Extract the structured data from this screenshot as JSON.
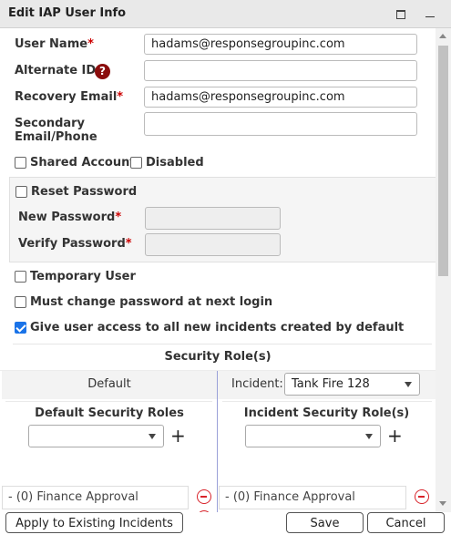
{
  "dialog": {
    "title": "Edit IAP User Info"
  },
  "form": {
    "user_name": {
      "label": "User Name",
      "required_mark": "*",
      "value": "hadams@responsegroupinc.com"
    },
    "alternate_id": {
      "label": "Alternate ID",
      "help": "?",
      "value": ""
    },
    "recovery_email": {
      "label": "Recovery Email",
      "required_mark": "*",
      "value": "hadams@responsegroupinc.com"
    },
    "secondary": {
      "label_line1": "Secondary",
      "label_line2": "Email/Phone",
      "value": ""
    },
    "shared_account": {
      "label": "Shared Account",
      "checked": false
    },
    "disabled": {
      "label": "Disabled",
      "checked": false
    },
    "reset_password": {
      "label": "Reset Password",
      "checked": false
    },
    "new_password": {
      "label": "New Password",
      "required_mark": "*"
    },
    "verify_password": {
      "label": "Verify Password",
      "required_mark": "*"
    },
    "temporary_user": {
      "label": "Temporary User",
      "checked": false
    },
    "must_change": {
      "label": "Must change password at next login",
      "checked": false
    },
    "give_access": {
      "label": "Give user access to all new incidents created by default",
      "checked": true
    }
  },
  "roles": {
    "section_title": "Security Role(s)",
    "default_tab": "Default",
    "incident_label": "Incident:",
    "incident_value": "Tank Fire 128",
    "default_roles_title": "Default Security Roles",
    "incident_roles_title": "Incident Security Role(s)",
    "add_symbol": "+",
    "left_items": [
      "- (0) Finance Approval"
    ],
    "right_items": [
      "- (0) Finance Approval"
    ]
  },
  "footer": {
    "apply": "Apply to Existing Incidents",
    "save": "Save",
    "cancel": "Cancel"
  },
  "colors": {
    "accent": "#1a73e8",
    "required": "#cc0000",
    "remove": "#d8232a",
    "help": "#8b0d0d"
  }
}
